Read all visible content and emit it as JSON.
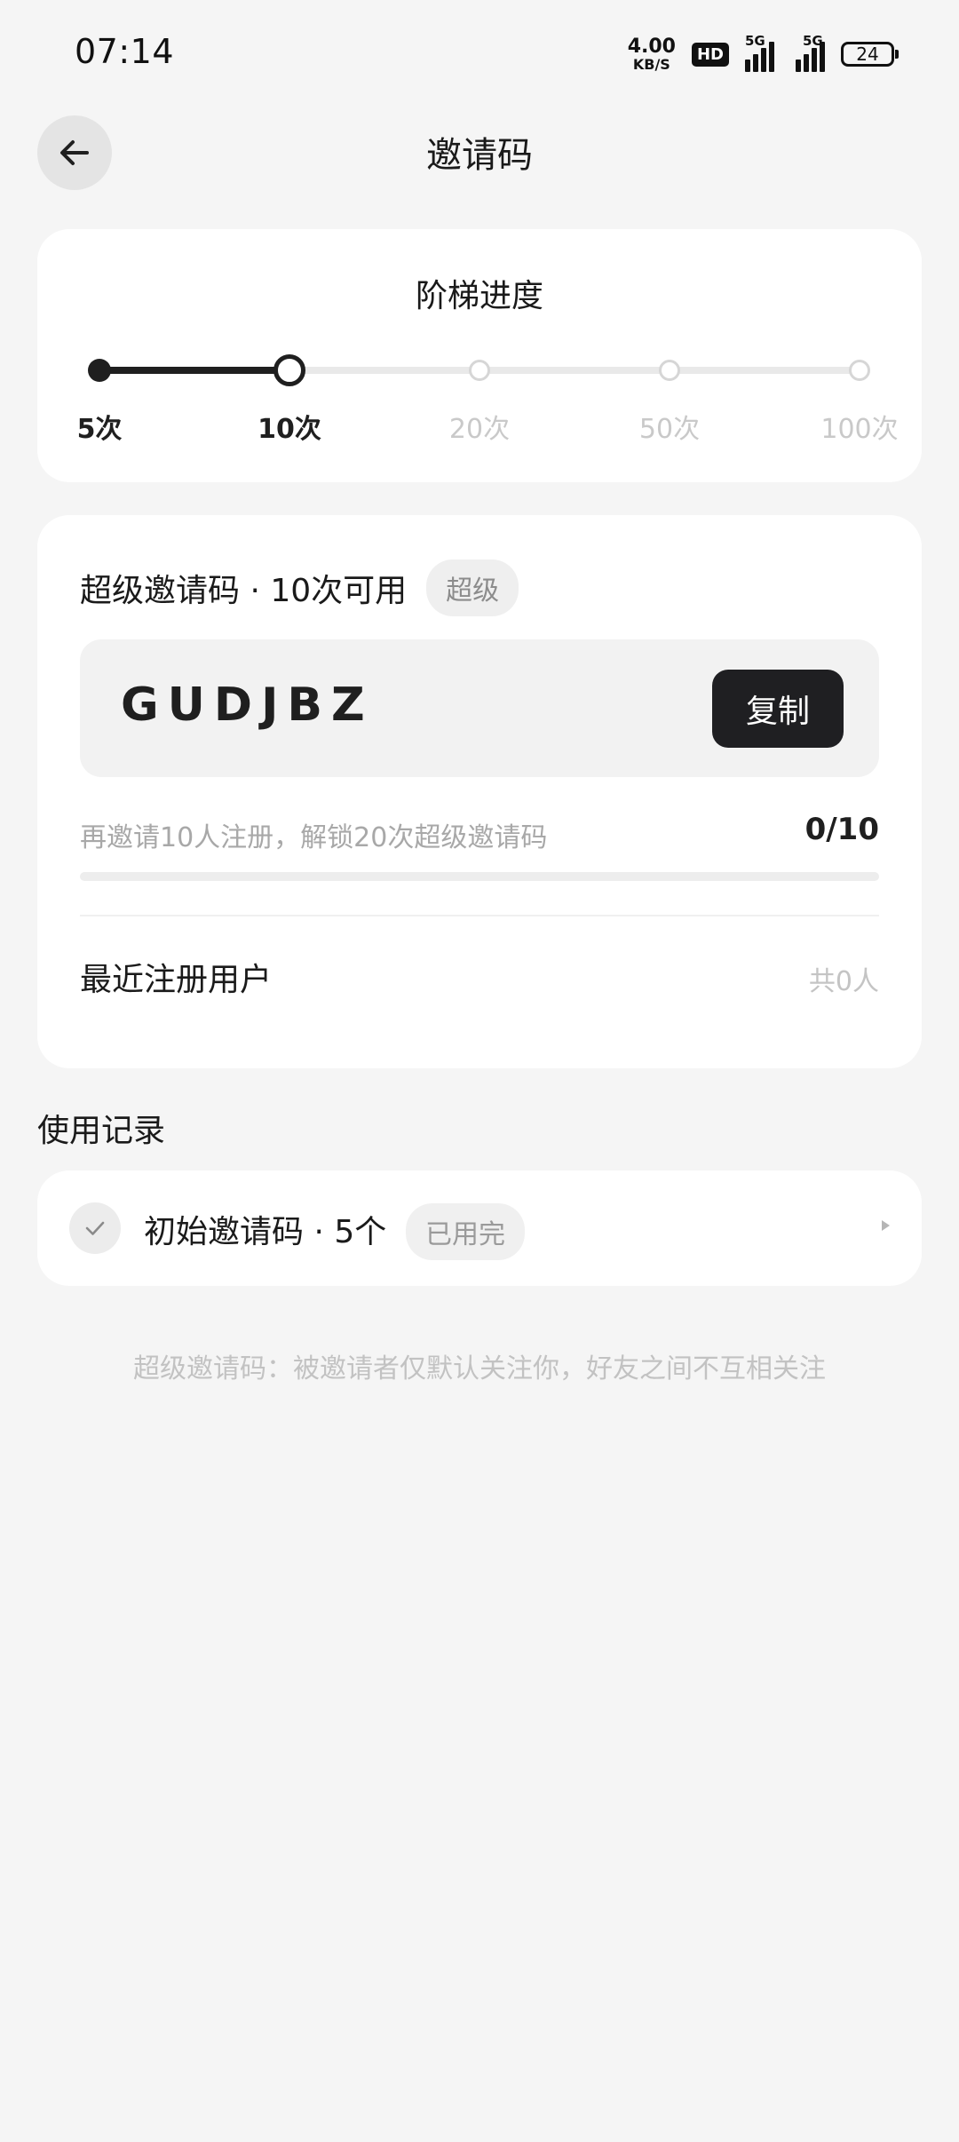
{
  "status_bar": {
    "time": "07:14",
    "net_speed_value": "4.00",
    "net_speed_unit": "KB/S",
    "hd_label": "HD",
    "sim1_label": "5G",
    "sim2_label": "5G",
    "battery_level": "24"
  },
  "header": {
    "title": "邀请码"
  },
  "ladder": {
    "title": "阶梯进度",
    "steps": [
      {
        "label": "5次",
        "state": "done"
      },
      {
        "label": "10次",
        "state": "current"
      },
      {
        "label": "20次",
        "state": "future"
      },
      {
        "label": "50次",
        "state": "future"
      },
      {
        "label": "100次",
        "state": "future"
      }
    ]
  },
  "invite": {
    "heading": "超级邀请码 · 10次可用",
    "badge": "超级",
    "code": "GUDJBZ",
    "copy_label": "复制",
    "unlock_hint": "再邀请10人注册，解锁20次超级邀请码",
    "unlock_count": "0/10",
    "unlock_progress": 0,
    "recent_label": "最近注册用户",
    "recent_count": "共0人"
  },
  "usage": {
    "title": "使用记录",
    "records": [
      {
        "text": "初始邀请码 · 5个",
        "status": "已用完"
      }
    ]
  },
  "footnote": "超级邀请码：被邀请者仅默认关注你，好友之间不互相关注",
  "colors": {
    "background": "#f5f5f5",
    "card": "#ffffff",
    "accent_dark": "#1f1f1f",
    "muted_text": "#c2c2c2"
  }
}
